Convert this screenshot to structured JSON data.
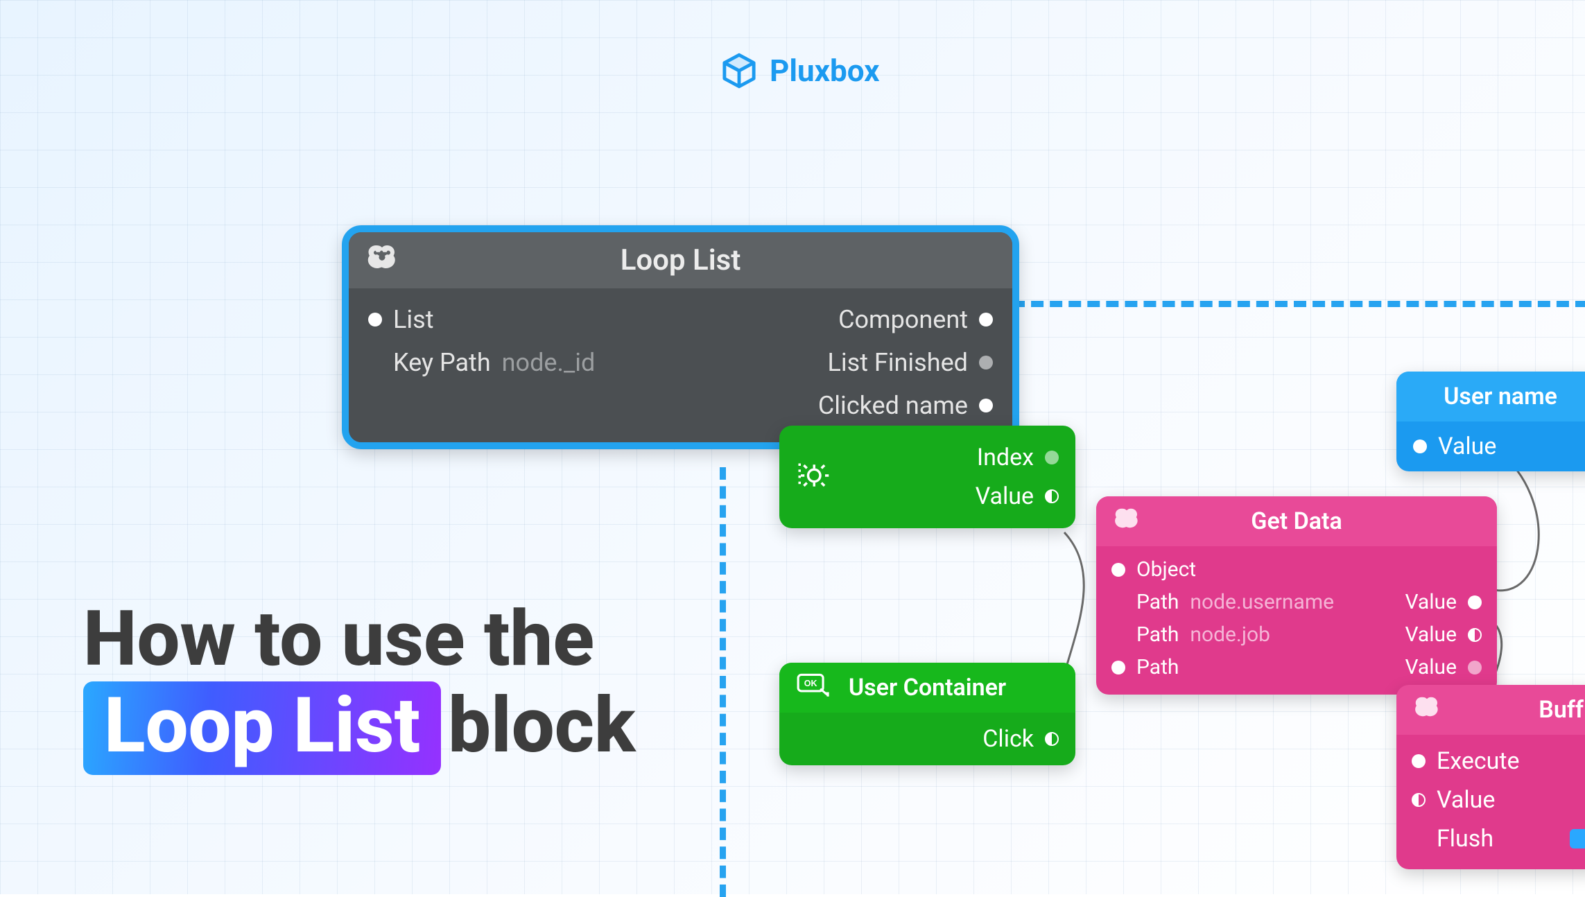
{
  "brand": {
    "name": "Pluxbox"
  },
  "headline": {
    "line1": "How to use the",
    "highlight": "Loop List",
    "after_highlight": "block"
  },
  "nodes": {
    "loop_list": {
      "title": "Loop List",
      "inputs": {
        "list": "List",
        "key_path_label": "Key Path",
        "key_path_placeholder": "node._id"
      },
      "outputs": {
        "component": "Component",
        "list_finished": "List Finished",
        "clicked_name": "Clicked name"
      }
    },
    "gear": {
      "index": "Index",
      "value": "Value"
    },
    "user_container": {
      "title": "User Container",
      "click": "Click"
    },
    "get_data": {
      "title": "Get Data",
      "object": "Object",
      "path_label": "Path",
      "value_label": "Value",
      "paths": [
        "node.username",
        "node.job",
        ""
      ]
    },
    "user_name": {
      "title": "User name",
      "value": "Value"
    },
    "buffer": {
      "title": "Buff",
      "execute": "Execute",
      "value": "Value",
      "flush": "Flush"
    }
  }
}
